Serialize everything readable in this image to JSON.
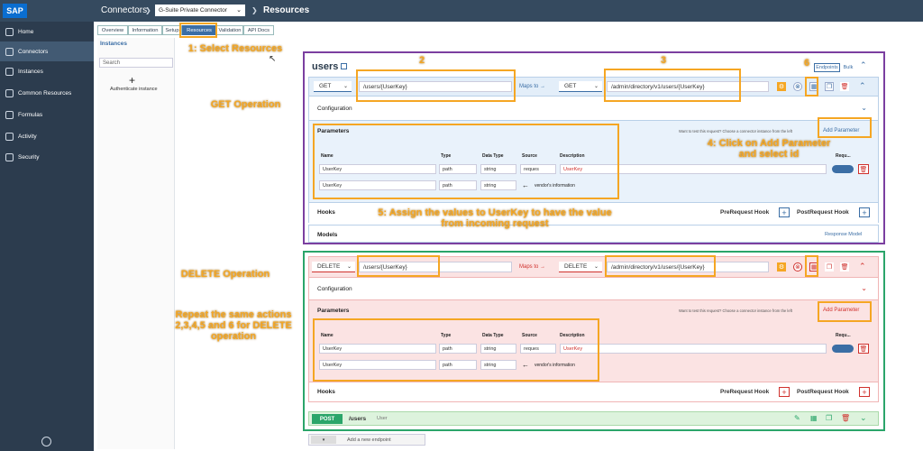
{
  "brand": "SAP",
  "breadcrumb": {
    "connectors": "Connectors",
    "connector_select": "G-Suite Private Connector",
    "resources": "Resources"
  },
  "nav": [
    "Home",
    "Connectors",
    "Instances",
    "Common Resources",
    "Formulas",
    "Activity",
    "Security"
  ],
  "tabs": [
    "Overview",
    "Information",
    "Setup",
    "Resources",
    "Validation",
    "API Docs"
  ],
  "instances": {
    "title": "Instances",
    "search_placeholder": "Search",
    "authenticate": "Authenticate instance",
    "add": "+"
  },
  "resource": {
    "name": "users",
    "endpoints_label": "Endpoints",
    "bulk_label": "Bulk",
    "add_endpoint": "Add a new endpoint"
  },
  "get_op": {
    "method": "GET",
    "path": "/users/{UserKey}",
    "maps_to": "Maps to →",
    "target_method": "GET",
    "target_path": "/admin/directory/v1/users/{UserKey}",
    "configuration": "Configuration",
    "parameters": "Parameters",
    "test_hint": "Want to test this request? Choose a connector instance from the left",
    "add_parameter": "Add Parameter",
    "headers": {
      "name": "Name",
      "type": "Type",
      "data_type": "Data Type",
      "source": "Source",
      "description": "Description",
      "required": "Requ..."
    },
    "row1": {
      "name": "UserKey",
      "type": "path",
      "data_type": "string",
      "source": "reques",
      "description": "UserKey"
    },
    "row2": {
      "name": "UserKey",
      "type": "path",
      "data_type": "string",
      "note": "vendor's information"
    },
    "hooks": "Hooks",
    "prerequest": "PreRequest Hook",
    "postrequest": "PostRequest Hook",
    "models": "Models",
    "response_model": "Response Model"
  },
  "delete_op": {
    "method": "DELETE",
    "path": "/users/{UserKey}",
    "maps_to": "Maps to →",
    "target_method": "DELETE",
    "target_path": "/admin/directory/v1/users/{UserKey}",
    "configuration": "Configuration",
    "parameters": "Parameters",
    "test_hint": "Want to test this request? Choose a connector instance from the left",
    "add_parameter": "Add Parameter",
    "headers": {
      "name": "Name",
      "type": "Type",
      "data_type": "Data Type",
      "source": "Source",
      "description": "Description",
      "required": "Requ..."
    },
    "row1": {
      "name": "UserKey",
      "type": "path",
      "data_type": "string",
      "source": "reques",
      "description": "UserKey"
    },
    "row2": {
      "name": "UserKey",
      "type": "path",
      "data_type": "string",
      "note": "vendor's information"
    },
    "hooks": "Hooks",
    "prerequest": "PreRequest Hook",
    "postrequest": "PostRequest Hook"
  },
  "post_op": {
    "method": "POST",
    "path": "/users",
    "label": "User"
  },
  "annotations": {
    "a1": "1: Select Resources",
    "a2": "2",
    "a3": "3",
    "a4": "4: Click on Add Parameter and select id",
    "a5": "5: Assign the values to UserKey to have the value from incoming request",
    "a6": "6",
    "get": "GET Operation",
    "delete": "DELETE Operation",
    "repeat": "Repeat the same actions 2,3,4,5 and 6 for DELETE operation"
  },
  "colors": {
    "topbar": "#354a5f",
    "sidenav": "#2c3c4e",
    "accent": "#3b6ea5",
    "annotation": "#f5a623",
    "get_frame": "#7b3fa0",
    "delete_frame": "#2ba56a",
    "delete_bg": "#fbe3e3",
    "post_bg": "#ddf3dd"
  }
}
